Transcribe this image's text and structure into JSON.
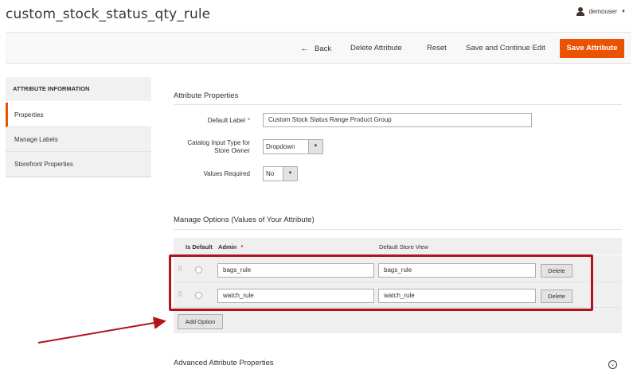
{
  "header": {
    "title": "custom_stock_status_qty_rule",
    "user": "demouser"
  },
  "actions": {
    "back": "Back",
    "delete": "Delete Attribute",
    "reset": "Reset",
    "save_continue": "Save and Continue Edit",
    "save": "Save Attribute"
  },
  "sidebar": {
    "title": "ATTRIBUTE INFORMATION",
    "items": [
      {
        "label": "Properties",
        "active": true
      },
      {
        "label": "Manage Labels",
        "active": false
      },
      {
        "label": "Storefront Properties",
        "active": false
      }
    ]
  },
  "properties": {
    "heading": "Attribute Properties",
    "default_label": {
      "label": "Default Label",
      "required_mark": "*",
      "value": "Custom Stock Status Range Product Group"
    },
    "input_type": {
      "label_line1": "Catalog Input Type for",
      "label_line2": "Store Owner",
      "value": "Dropdown"
    },
    "values_required": {
      "label": "Values Required",
      "value": "No"
    }
  },
  "options": {
    "heading": "Manage Options (Values of Your Attribute)",
    "columns": {
      "is_default": "Is Default",
      "admin": "Admin",
      "admin_required": "*",
      "store_view": "Default Store View"
    },
    "rows": [
      {
        "admin": "bags_rule",
        "store_view": "bags_rule",
        "delete": "Delete"
      },
      {
        "admin": "watch_rule",
        "store_view": "watch_rule",
        "delete": "Delete"
      }
    ],
    "add_option": "Add Option"
  },
  "advanced": {
    "heading": "Advanced Attribute Properties"
  },
  "colors": {
    "accent": "#eb5202",
    "annotation": "#b0151b"
  }
}
